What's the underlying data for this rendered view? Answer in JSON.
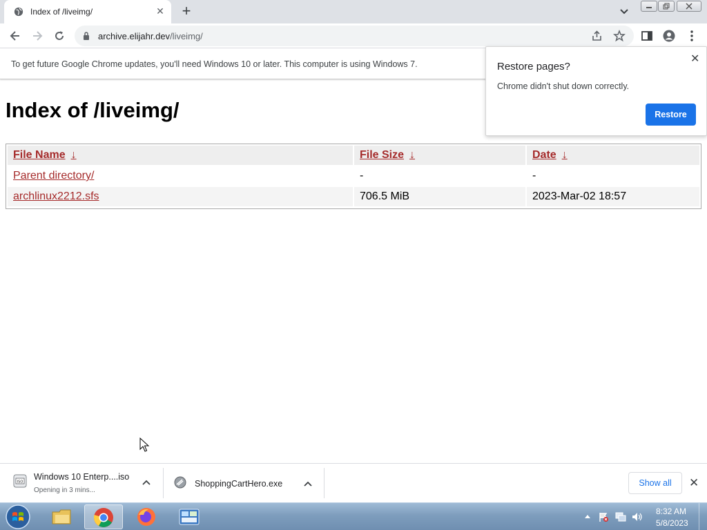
{
  "browser": {
    "tab_title": "Index of /liveimg/",
    "url_host": "archive.elijahr.dev",
    "url_path": "/liveimg/"
  },
  "infobar": {
    "message": "To get future Google Chrome updates, you'll need Windows 10 or later. This computer is using Windows 7."
  },
  "page": {
    "title": "Index of /liveimg/",
    "columns": [
      "File Name",
      "File Size",
      "Date"
    ],
    "sort_arrow": "↓",
    "rows": [
      {
        "name": "Parent directory/",
        "size": "-",
        "date": "-"
      },
      {
        "name": "archlinux2212.sfs",
        "size": "706.5 MiB",
        "date": "2023-Mar-02 18:57"
      }
    ]
  },
  "restore_popup": {
    "title": "Restore pages?",
    "message": "Chrome didn't shut down correctly.",
    "button": "Restore"
  },
  "downloads": {
    "items": [
      {
        "name": "Windows 10 Enterp....iso",
        "status": "Opening in 3 mins..."
      },
      {
        "name": "ShoppingCartHero.exe",
        "status": ""
      }
    ],
    "show_all": "Show all"
  },
  "taskbar": {
    "time": "8:32 AM",
    "date": "5/8/2023"
  },
  "colors": {
    "link": "#a52a2a",
    "accent": "#1a73e8"
  }
}
